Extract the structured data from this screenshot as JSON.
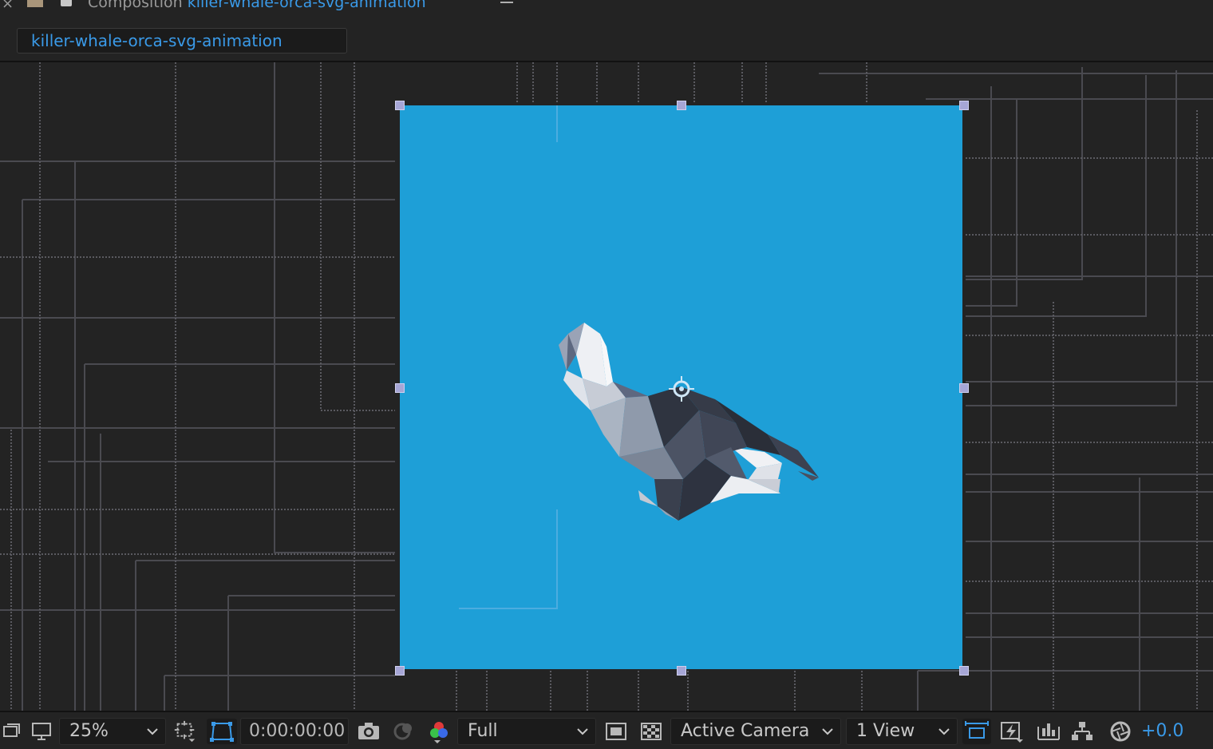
{
  "panel": {
    "label": "Composition",
    "comp_name": "killer-whale-orca-svg-animation"
  },
  "tab": {
    "label": "killer-whale-orca-svg-animation"
  },
  "toolbar": {
    "zoom": "25%",
    "timecode": "0:00:00:00",
    "resolution": "Full",
    "camera": "Active Camera",
    "view_layout": "1 View",
    "exposure": "+0.0"
  },
  "colors": {
    "comp_background": "#1e9fd7",
    "accent": "#3a9ae8",
    "panel_bg": "#232323"
  },
  "icons": [
    "close-icon",
    "folder-icon",
    "lock-icon",
    "panel-menu-icon",
    "always-preview-icon",
    "monitor-icon",
    "region-of-interest-icon",
    "safe-margins-icon",
    "snapshot-camera-icon",
    "show-snapshot-icon",
    "rgb-channels-icon",
    "fast-preview-icon",
    "transparency-grid-icon",
    "toggle-pixel-aspect-icon",
    "fast-draft-icon",
    "timeline-icon",
    "flowchart-icon",
    "exposure-reset-icon",
    "anchor-point-icon"
  ]
}
